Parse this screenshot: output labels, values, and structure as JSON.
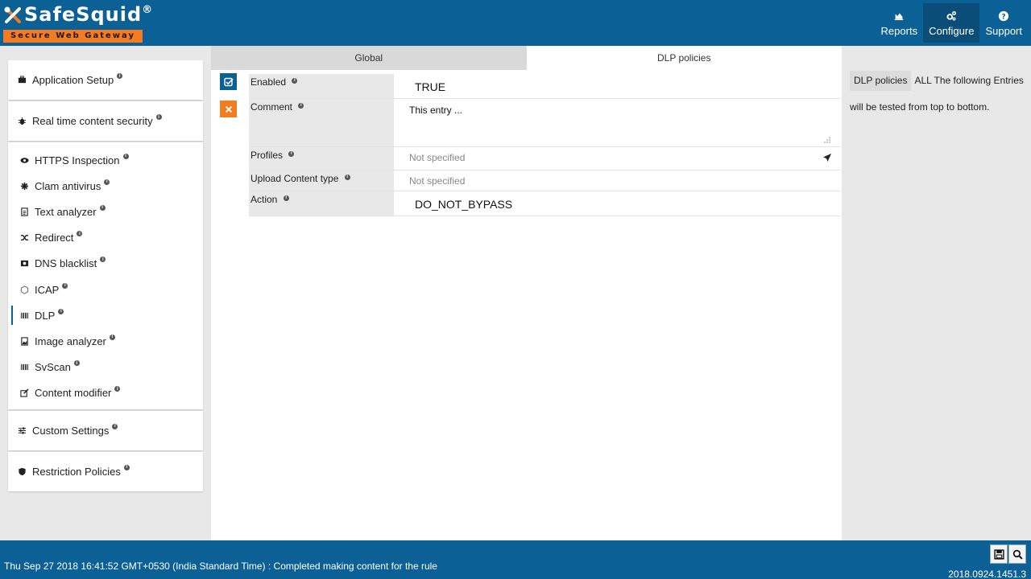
{
  "brand": {
    "name": "SafeSquid",
    "reg": "®",
    "tagline": "Secure Web Gateway",
    "orange": "#f47b20",
    "blue": "#0b6096"
  },
  "nav": {
    "reports": "Reports",
    "configure": "Configure",
    "support": "Support"
  },
  "sidebar": {
    "application_setup": "Application Setup",
    "real_time": "Real time content security",
    "items": [
      {
        "label": "HTTPS Inspection",
        "icon": "eye-icon"
      },
      {
        "label": "Clam antivirus",
        "icon": "bug-icon"
      },
      {
        "label": "Text analyzer",
        "icon": "file-text-icon"
      },
      {
        "label": "Redirect",
        "icon": "shuffle-icon"
      },
      {
        "label": "DNS blacklist",
        "icon": "dns-icon"
      },
      {
        "label": "ICAP",
        "icon": "hexagon-icon"
      },
      {
        "label": "DLP",
        "icon": "barcode-icon"
      },
      {
        "label": "Image analyzer",
        "icon": "image-icon"
      },
      {
        "label": "SvScan",
        "icon": "barcode-icon"
      },
      {
        "label": "Content modifier",
        "icon": "edit-icon"
      }
    ],
    "custom_settings": "Custom Settings",
    "restriction_policies": "Restriction Policies",
    "info_glyph": "i"
  },
  "tabs": {
    "global": "Global",
    "dlp": "DLP policies"
  },
  "form": {
    "enabled_label": "Enabled",
    "enabled_value": "TRUE",
    "comment_label": "Comment",
    "comment_value": "This entry ...",
    "profiles_label": "Profiles",
    "profiles_value": "Not specified",
    "upload_label": "Upload Content type",
    "upload_value": "Not specified",
    "action_label": "Action",
    "action_value": "DO_NOT_BYPASS"
  },
  "help": {
    "tag": "DLP policies",
    "text1": "ALL The following Entries",
    "text2": "will be tested from top to bottom."
  },
  "footer": {
    "status": "Thu Sep 27 2018 16:41:52 GMT+0530 (India Standard Time) : Completed making content for the rule",
    "version": "2018.0924.1451.3"
  }
}
